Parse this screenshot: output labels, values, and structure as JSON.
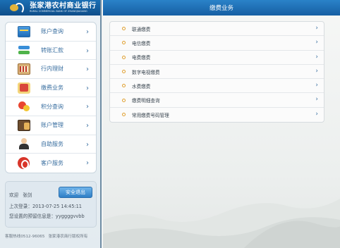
{
  "brand": {
    "name_cn": "张家港农村商业银行",
    "name_en": "RURAL COMMERCIAL BANK OF ZHANGJIAGANG"
  },
  "sidebar": {
    "items": [
      {
        "label": "账户查询",
        "icon": "bank-card-icon"
      },
      {
        "label": "转账汇款",
        "icon": "transfer-arrows-icon"
      },
      {
        "label": "行内理财",
        "icon": "abacus-icon"
      },
      {
        "label": "缴费业务",
        "icon": "payment-icon"
      },
      {
        "label": "积分查询",
        "icon": "points-icon"
      },
      {
        "label": "账户管理",
        "icon": "account-management-icon"
      },
      {
        "label": "自助服务",
        "icon": "self-service-icon"
      },
      {
        "label": "客户服务",
        "icon": "customer-service-icon"
      }
    ]
  },
  "user": {
    "welcome": "欢迎",
    "name": "张剑",
    "logout_label": "安全退出",
    "last_login": "上次登录：2013-07-25 14:45:11",
    "reserved_info": "您设置的预留信息是：yyggggvvbb"
  },
  "footer": {
    "hotline": "客服热线0512-96065",
    "copyright": "张家港农商行版权所有"
  },
  "main": {
    "title": "缴费业务",
    "items": [
      {
        "label": "联通缴费"
      },
      {
        "label": "电信缴费"
      },
      {
        "label": "电费缴费"
      },
      {
        "label": "数字电视缴费"
      },
      {
        "label": "水费缴费"
      },
      {
        "label": "缴费明细查询"
      },
      {
        "label": "常用缴费号码管理"
      }
    ]
  },
  "colors": {
    "header_blue": "#1b6fb4",
    "link_blue": "#3a6fa0",
    "bullet_orange": "#e0a030"
  }
}
